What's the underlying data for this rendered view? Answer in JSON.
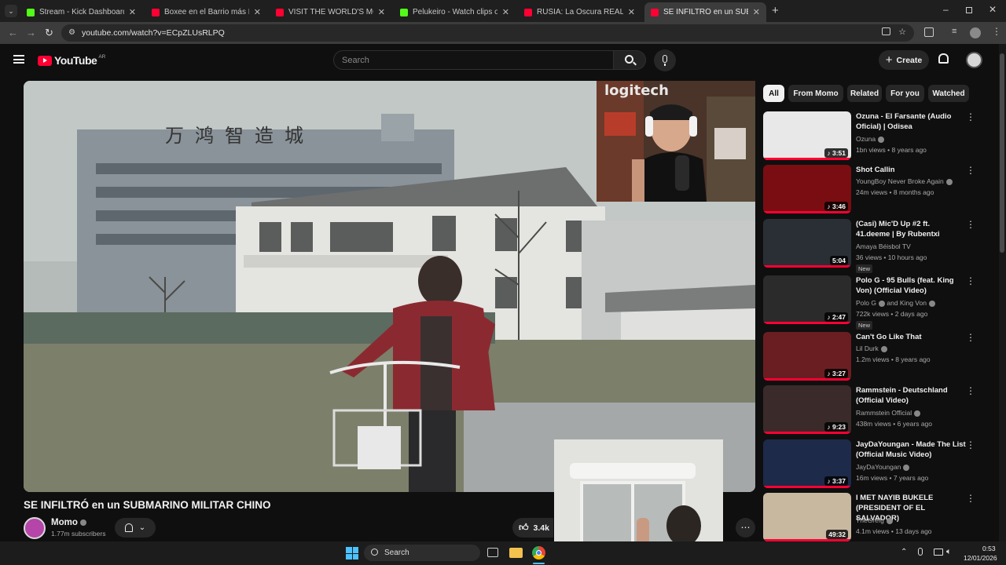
{
  "browser": {
    "tabs": [
      {
        "title": "Stream - Kick Dashboard",
        "fav_color": "#53fc18"
      },
      {
        "title": "Boxee en el Barrio más Peligros",
        "fav_color": "#ff0033"
      },
      {
        "title": "VISIT THE WORLD'S MOST HU",
        "fav_color": "#ff0033"
      },
      {
        "title": "Pelukeiro - Watch clips on Kick",
        "fav_color": "#53fc18"
      },
      {
        "title": "RUSIA: La Oscura REALIDAD de",
        "fav_color": "#ff0033"
      },
      {
        "title": "SE INFILTRÓ en un SUBMARINC",
        "fav_color": "#ff0033"
      }
    ],
    "url": "youtube.com/watch?v=ECpZLUsRLPQ"
  },
  "youtube": {
    "logo_text": "YouTube",
    "region": "AR",
    "search_placeholder": "Search",
    "create_label": "Create"
  },
  "filters": [
    "All",
    "From Momo",
    "Related",
    "For you",
    "Watched"
  ],
  "recommendations": [
    {
      "title": "Ozuna - El Farsante (Audio Oficial) | Odisea",
      "channel": "Ozuna",
      "verified": true,
      "meta": "1bn views • 8 years ago",
      "duration": "3:51",
      "music": true,
      "new": false,
      "thumb": "#e8e8e8"
    },
    {
      "title": "Shot Callin",
      "channel": "YoungBoy Never Broke Again",
      "verified": true,
      "meta": "24m views • 8 months ago",
      "duration": "3:46",
      "music": true,
      "new": false,
      "thumb": "#7a0d12"
    },
    {
      "title": "(Casi) Mic'D Up #2 ft. 41.deeme | By Rubentxi",
      "channel": "Amaya Béisbol TV",
      "verified": false,
      "meta": "36 views • 10 hours ago",
      "duration": "5:04",
      "music": false,
      "new": true,
      "thumb": "#2a2f36"
    },
    {
      "title": "Polo G - 95 Bulls (feat. King Von) (Official Video)",
      "channel": "Polo G",
      "channel2": "and King Von",
      "verified": true,
      "meta": "722k views • 2 days ago",
      "duration": "2:47",
      "music": true,
      "new": true,
      "thumb": "#2b2b2b"
    },
    {
      "title": "Can't Go Like That",
      "channel": "Lil Durk",
      "verified": true,
      "meta": "1.2m views • 8 years ago",
      "duration": "3:27",
      "music": true,
      "new": false,
      "thumb": "#6b1e22"
    },
    {
      "title": "Rammstein - Deutschland (Official Video)",
      "channel": "Rammstein Official",
      "verified": true,
      "meta": "438m views • 6 years ago",
      "duration": "9:23",
      "music": true,
      "new": false,
      "thumb": "#3a2a2a"
    },
    {
      "title": "JayDaYoungan - Made The List (Official Music Video)",
      "channel": "JayDaYoungan",
      "verified": true,
      "meta": "16m views • 7 years ago",
      "duration": "3:37",
      "music": true,
      "new": false,
      "thumb": "#1d2a4a"
    },
    {
      "title": "I MET NAYIB BUKELE (PRESIDENT OF EL SALVADOR)",
      "channel": "TheGrefg",
      "verified": true,
      "meta": "4.1m views • 13 days ago",
      "duration": "49:32",
      "music": false,
      "new": false,
      "thumb": "#c9b8a0"
    }
  ],
  "video": {
    "title": "SE INFILTRÓ en un SUBMARINO MILITAR CHINO",
    "channel": "Momo",
    "subscribers": "1.77m subscribers",
    "likes": "3.4k",
    "overlay_sign": "万鸿智造城",
    "webcam_brand": "logitech"
  },
  "taskbar": {
    "search_placeholder": "Search",
    "time": "0:53",
    "date": "12/01/2026"
  }
}
